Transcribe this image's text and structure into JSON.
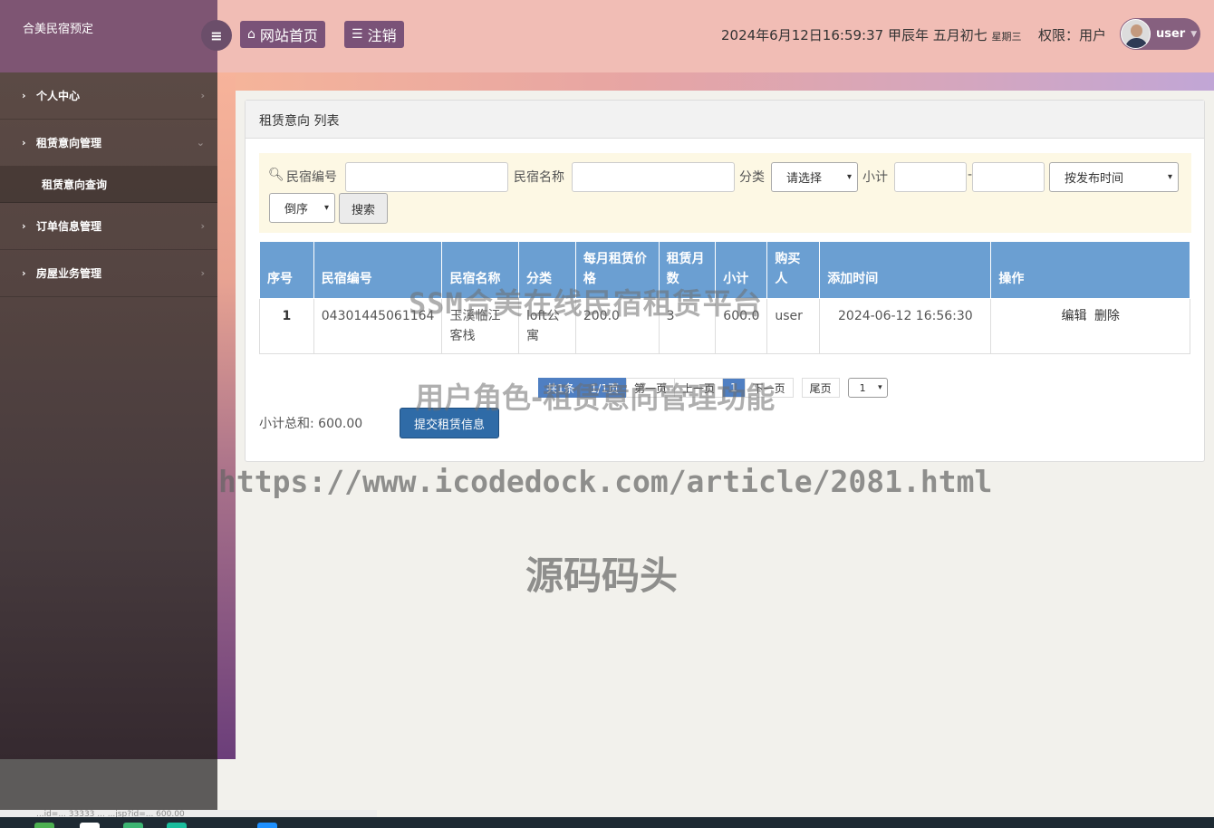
{
  "sidebar": {
    "brand": "合美民宿预定",
    "items": [
      {
        "label": "个人中心"
      },
      {
        "label": "租赁意向管理"
      },
      {
        "label": "订单信息管理"
      },
      {
        "label": "房屋业务管理"
      }
    ],
    "submenu": {
      "label": "租赁意向查询"
    }
  },
  "header": {
    "home_label": "网站首页",
    "logout_label": "注销",
    "datetime": "2024年6月12日16:59:37 甲辰年 五月初七",
    "weekday": "星期三",
    "role": "权限：用户",
    "username": "user"
  },
  "panel": {
    "title": "租赁意向 列表"
  },
  "search": {
    "label_code": "民宿编号",
    "label_name": "民宿名称",
    "label_category": "分类",
    "category_selected": "请选择",
    "label_subtotal": "小计",
    "range_sep": "-",
    "sort_field": "按发布时间",
    "sort_order": "倒序",
    "button": "搜索"
  },
  "table": {
    "headers": [
      "序号",
      "民宿编号",
      "民宿名称",
      "分类",
      "每月租赁价格",
      "租赁月数",
      "小计",
      "购买人",
      "添加时间",
      "操作"
    ],
    "rows": [
      {
        "index": "1",
        "code": "04301445061164",
        "name": "玉溪临江客栈",
        "category": "loft公寓",
        "price": "200.0",
        "months": "3",
        "subtotal": "600.0",
        "buyer": "user",
        "time": "2024-06-12 16:56:30",
        "edit": "编辑",
        "delete": "删除"
      }
    ]
  },
  "pager": {
    "total": "共1条",
    "pages": "1/1页",
    "first": "第一页",
    "prev": "上一页",
    "current": "1",
    "next": "下一页",
    "last": "尾页",
    "page_select": "1"
  },
  "footer": {
    "subtotal_sum": "小计总和: 600.00",
    "submit": "提交租赁信息"
  },
  "watermarks": {
    "title": "SSM合美在线民宿租赁平台",
    "subtitle": "用户角色-租赁意向管理功能",
    "url": "https://www.icodedock.com/article/2081.html",
    "brand": "源码码头"
  },
  "status_bar": {
    "text": "...id=... 33333 ... ...jsp?id=... 600.00"
  },
  "colors": {
    "sidebar_top": "#7e5573",
    "header_bg": "#f1bdb5",
    "table_header": "#6b9fd2",
    "submit_button": "#2f6ba7",
    "search_bg": "#fdf8e4"
  }
}
